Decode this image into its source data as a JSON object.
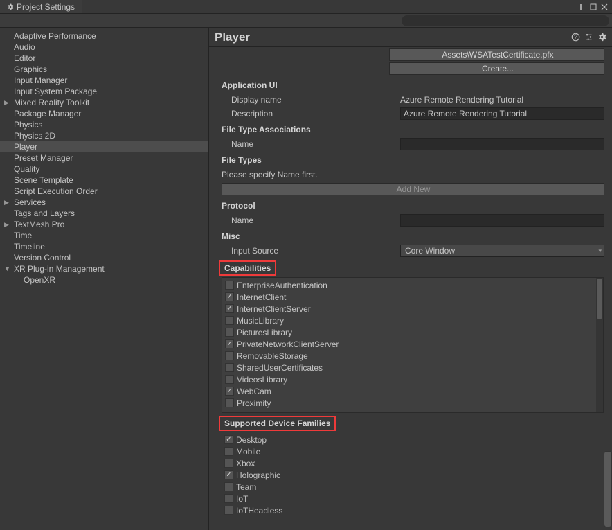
{
  "window": {
    "title": "Project Settings",
    "header_title": "Player"
  },
  "search": {
    "placeholder": ""
  },
  "sidebar": [
    {
      "label": "Adaptive Performance",
      "indent": 1,
      "expand": null
    },
    {
      "label": "Audio",
      "indent": 1,
      "expand": null
    },
    {
      "label": "Editor",
      "indent": 1,
      "expand": null
    },
    {
      "label": "Graphics",
      "indent": 1,
      "expand": null
    },
    {
      "label": "Input Manager",
      "indent": 1,
      "expand": null
    },
    {
      "label": "Input System Package",
      "indent": 1,
      "expand": null
    },
    {
      "label": "Mixed Reality Toolkit",
      "indent": 1,
      "expand": "▶"
    },
    {
      "label": "Package Manager",
      "indent": 1,
      "expand": null
    },
    {
      "label": "Physics",
      "indent": 1,
      "expand": null
    },
    {
      "label": "Physics 2D",
      "indent": 1,
      "expand": null
    },
    {
      "label": "Player",
      "indent": 1,
      "expand": null,
      "selected": true
    },
    {
      "label": "Preset Manager",
      "indent": 1,
      "expand": null
    },
    {
      "label": "Quality",
      "indent": 1,
      "expand": null
    },
    {
      "label": "Scene Template",
      "indent": 1,
      "expand": null
    },
    {
      "label": "Script Execution Order",
      "indent": 1,
      "expand": null
    },
    {
      "label": "Services",
      "indent": 1,
      "expand": "▶"
    },
    {
      "label": "Tags and Layers",
      "indent": 1,
      "expand": null
    },
    {
      "label": "TextMesh Pro",
      "indent": 1,
      "expand": "▶"
    },
    {
      "label": "Time",
      "indent": 1,
      "expand": null
    },
    {
      "label": "Timeline",
      "indent": 1,
      "expand": null
    },
    {
      "label": "Version Control",
      "indent": 1,
      "expand": null
    },
    {
      "label": "XR Plug-in Management",
      "indent": 1,
      "expand": "▼"
    },
    {
      "label": "OpenXR",
      "indent": 2,
      "expand": null
    }
  ],
  "buttons": {
    "cert_path": "Assets\\WSATestCertificate.pfx",
    "create": "Create...",
    "add_new": "Add New"
  },
  "sections": {
    "app_ui": "Application UI",
    "file_assoc": "File Type Associations",
    "file_types": "File Types",
    "protocol": "Protocol",
    "misc": "Misc",
    "capabilities": "Capabilities",
    "device_families": "Supported Device Families"
  },
  "fields": {
    "display_name": {
      "label": "Display name",
      "value": "Azure Remote Rendering Tutorial"
    },
    "description": {
      "label": "Description",
      "value": "Azure Remote Rendering Tutorial"
    },
    "assoc_name": {
      "label": "Name",
      "value": ""
    },
    "file_types_msg": "Please specify Name first.",
    "proto_name": {
      "label": "Name",
      "value": ""
    },
    "input_source": {
      "label": "Input Source",
      "value": "Core Window"
    }
  },
  "capabilities": [
    {
      "label": "EnterpriseAuthentication",
      "checked": false
    },
    {
      "label": "InternetClient",
      "checked": true
    },
    {
      "label": "InternetClientServer",
      "checked": true
    },
    {
      "label": "MusicLibrary",
      "checked": false
    },
    {
      "label": "PicturesLibrary",
      "checked": false
    },
    {
      "label": "PrivateNetworkClientServer",
      "checked": true
    },
    {
      "label": "RemovableStorage",
      "checked": false
    },
    {
      "label": "SharedUserCertificates",
      "checked": false
    },
    {
      "label": "VideosLibrary",
      "checked": false
    },
    {
      "label": "WebCam",
      "checked": true
    },
    {
      "label": "Proximity",
      "checked": false
    }
  ],
  "device_families": [
    {
      "label": "Desktop",
      "checked": true
    },
    {
      "label": "Mobile",
      "checked": false
    },
    {
      "label": "Xbox",
      "checked": false
    },
    {
      "label": "Holographic",
      "checked": true
    },
    {
      "label": "Team",
      "checked": false
    },
    {
      "label": "IoT",
      "checked": false
    },
    {
      "label": "IoTHeadless",
      "checked": false
    }
  ]
}
